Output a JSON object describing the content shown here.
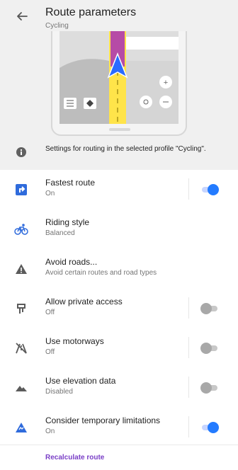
{
  "header": {
    "back_icon": "arrow-left-icon",
    "title": "Route parameters",
    "subtitle": "Cycling"
  },
  "info": {
    "icon": "info-icon",
    "text": "Settings for routing in the selected profile \"Cycling\"."
  },
  "settings": [
    {
      "label": "Fastest route",
      "sub": "On",
      "icon": "route-icon",
      "toggle": true,
      "enabled": true
    },
    {
      "label": "Riding style",
      "sub": "Balanced",
      "icon": "bicycle-icon",
      "toggle": false
    },
    {
      "label": "Avoid roads...",
      "sub": "Avoid certain routes and road types",
      "icon": "warning-icon",
      "toggle": false
    },
    {
      "label": "Allow private access",
      "sub": "Off",
      "icon": "gate-icon",
      "toggle": true,
      "enabled": false
    },
    {
      "label": "Use motorways",
      "sub": "Off",
      "icon": "motorway-icon",
      "toggle": true,
      "enabled": false
    },
    {
      "label": "Use elevation data",
      "sub": "Disabled",
      "icon": "mountain-icon",
      "toggle": true,
      "enabled": false
    },
    {
      "label": "Consider temporary limitations",
      "sub": "On",
      "icon": "traffic-cone-icon",
      "toggle": true,
      "enabled": true
    }
  ],
  "footer": {
    "recalculate_label": "Recalculate route"
  },
  "colors": {
    "accent": "#237bff",
    "route": "#ffeb3b",
    "highlight": "#b64ba6",
    "link": "#7a3fc7"
  }
}
